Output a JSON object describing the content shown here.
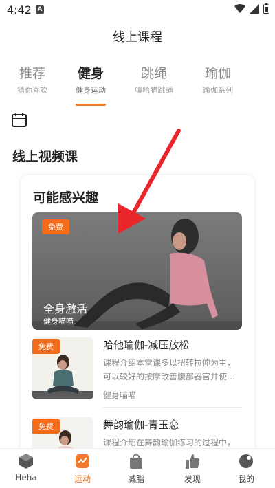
{
  "status_bar": {
    "time": "4:42",
    "notification_letter": "A"
  },
  "header": {
    "title": "线上课程"
  },
  "tabs": [
    {
      "label": "推荐",
      "sub": "猜你喜欢",
      "active": false
    },
    {
      "label": "健身",
      "sub": "健身运动",
      "active": true
    },
    {
      "label": "跳绳",
      "sub": "嘿哈猫跳绳",
      "active": false
    },
    {
      "label": "瑜伽",
      "sub": "瑜伽系列",
      "active": false
    }
  ],
  "section": {
    "title": "线上视频课"
  },
  "card": {
    "heading": "可能感兴趣",
    "featured": {
      "badge": "免费",
      "title": "全身激活",
      "author": "健身喵喵"
    },
    "items": [
      {
        "badge": "免费",
        "title": "哈他瑜伽-减压放松",
        "desc": "课程介绍本堂课多以扭转拉伸为主，可以较好的按摩改善腹部器官并使…",
        "author": "健身喵喵"
      },
      {
        "badge": "免费",
        "title": "舞韵瑜伽-青玉恋",
        "desc": "课程介绍在舞韵瑜伽练习的过程中，"
      }
    ]
  },
  "bottom_nav": [
    {
      "label": "Heha",
      "icon": "heha-logo-icon",
      "active": false
    },
    {
      "label": "运动",
      "icon": "sport-icon",
      "active": true
    },
    {
      "label": "减脂",
      "icon": "shopping-bag-icon",
      "active": false
    },
    {
      "label": "发现",
      "icon": "thumbs-up-icon",
      "active": false
    },
    {
      "label": "我的",
      "icon": "profile-icon",
      "active": false
    }
  ],
  "colors": {
    "accent": "#f07a2a",
    "badge": "#f36c1b",
    "arrow": "#e8262b"
  }
}
